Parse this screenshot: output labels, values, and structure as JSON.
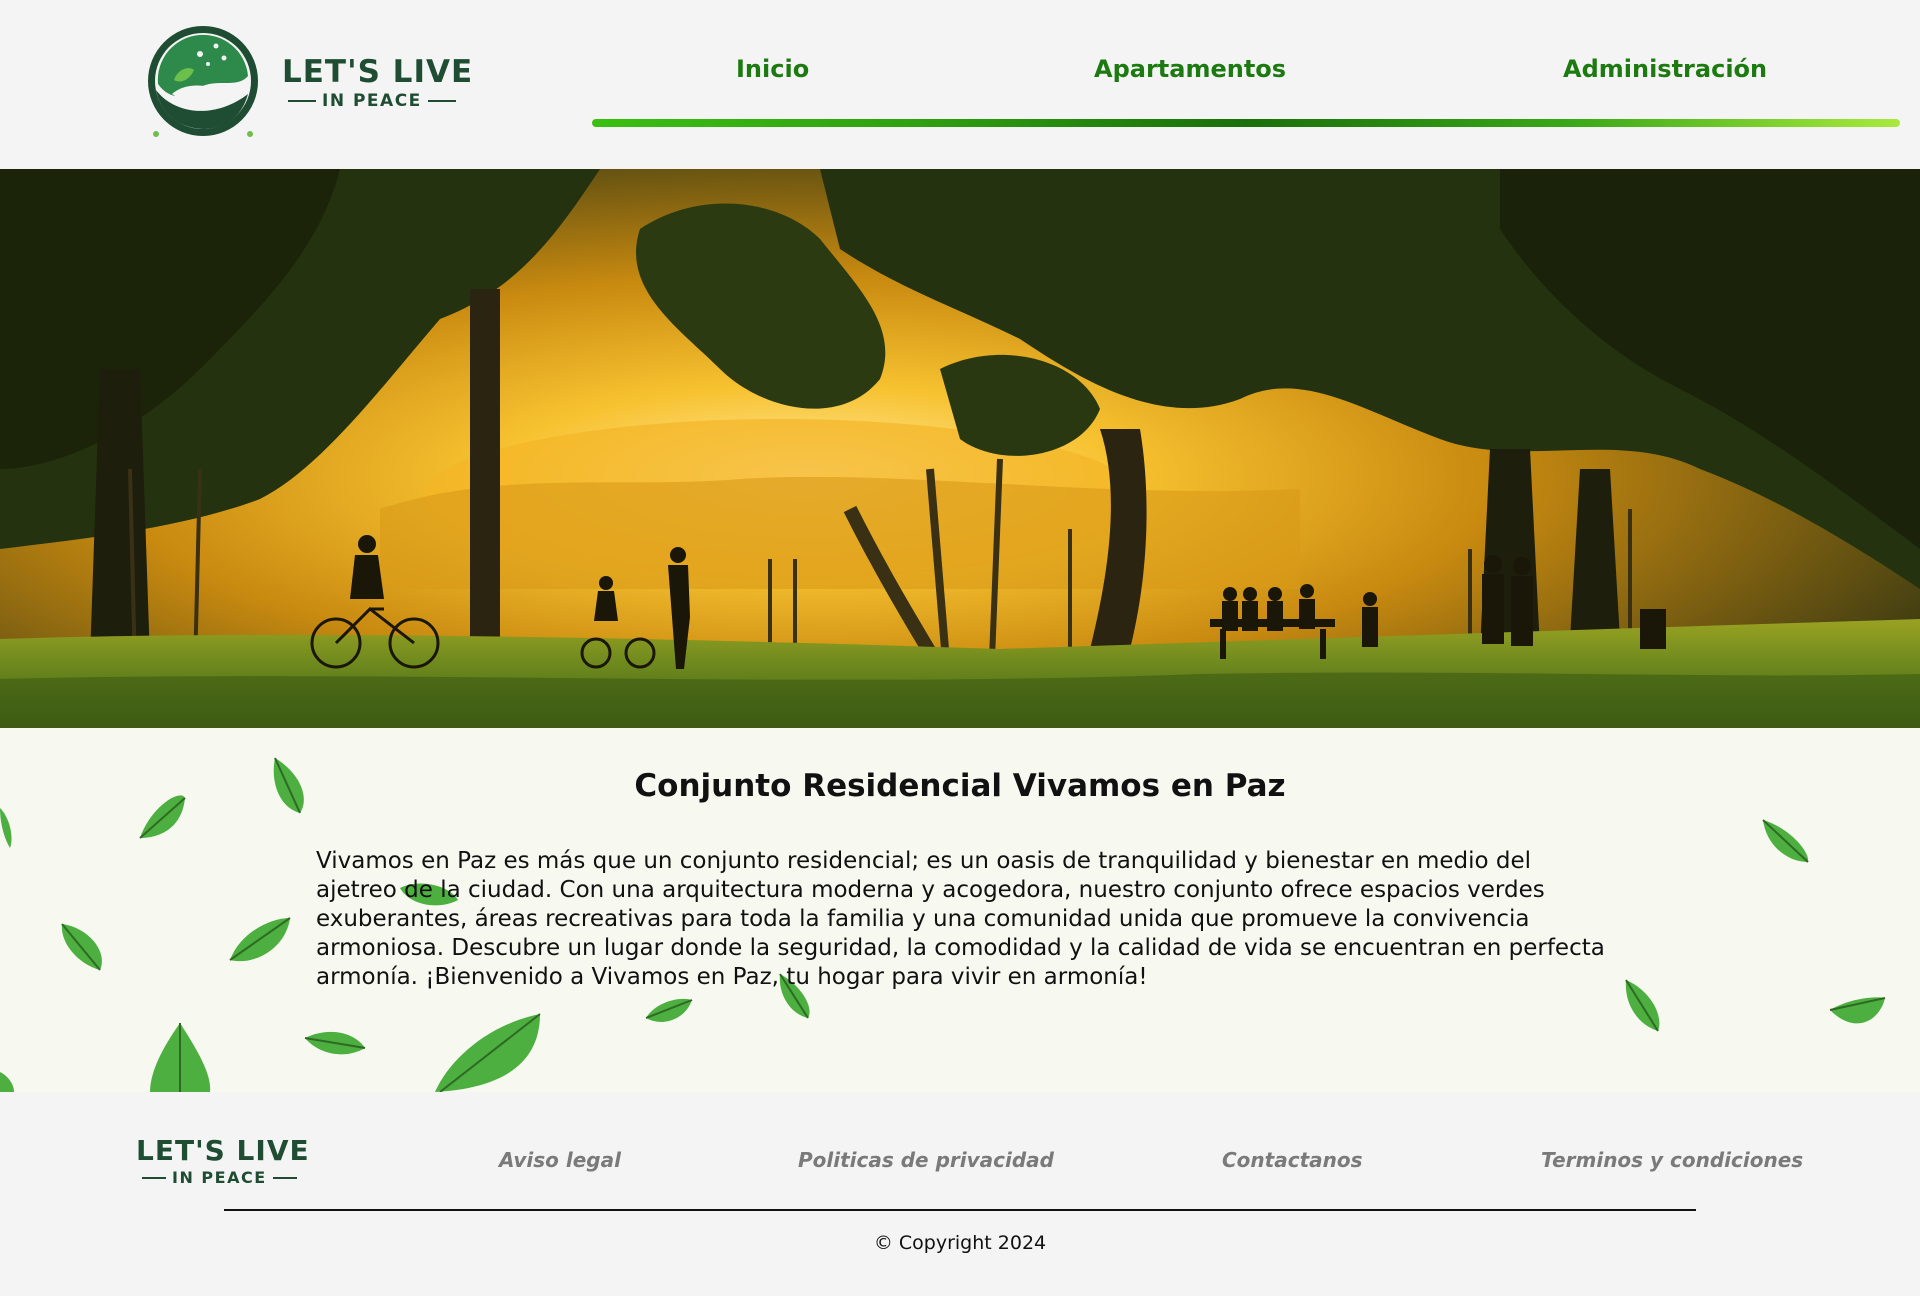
{
  "brand": {
    "line1": "LET'S LIVE",
    "line2": "IN PEACE"
  },
  "nav": {
    "items": [
      {
        "label": "Inicio"
      },
      {
        "label": "Apartamentos"
      },
      {
        "label": "Administración"
      }
    ]
  },
  "main": {
    "title": "Conjunto Residencial Vivamos en Paz",
    "description": "Vivamos en Paz es más que un conjunto residencial; es un oasis de tranquilidad y bienestar en medio del ajetreo de la ciudad. Con una arquitectura moderna y acogedora, nuestro conjunto ofrece espacios verdes exuberantes, áreas recreativas para toda la familia y una comunidad unida que promueve la convivencia armoniosa. Descubre un lugar donde la seguridad, la comodidad y la calidad de vida se encuentran en perfecta armonía. ¡Bienvenido a Vivamos en Paz, tu hogar para vivir en armonía!"
  },
  "footer": {
    "links": [
      {
        "label": "Aviso legal"
      },
      {
        "label": "Politicas de privacidad"
      },
      {
        "label": "Contactanos"
      },
      {
        "label": "Terminos y condiciones"
      }
    ],
    "copyright": "© Copyright 2024"
  },
  "colors": {
    "nav_text": "#1d7a10",
    "brand_dark": "#1f4d33",
    "leaf_green": "#4caf3f",
    "footer_link": "#7a7a7a"
  },
  "icons": [
    "logo-badge-icon",
    "leaf-icon"
  ]
}
